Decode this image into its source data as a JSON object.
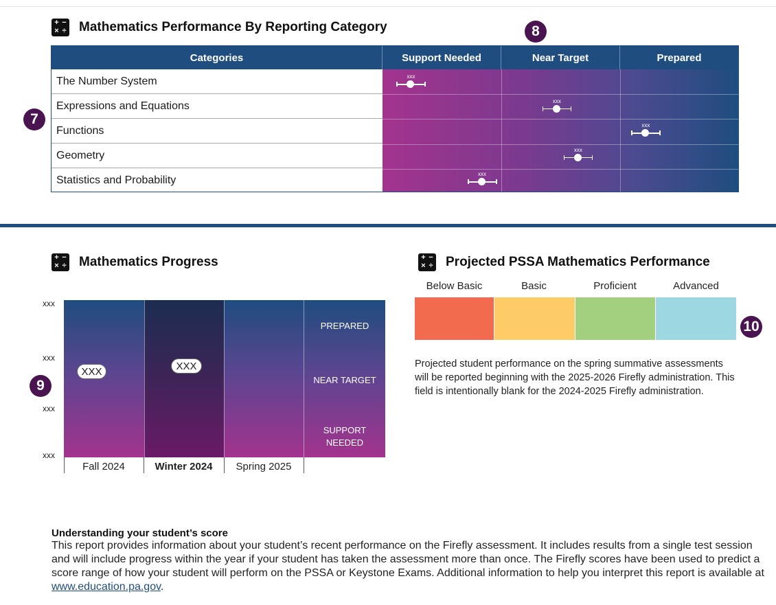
{
  "category_section": {
    "title": "Mathematics Performance By Reporting Category",
    "callout_rows": "7",
    "callout_columns": "8",
    "columns": [
      "Categories",
      "Support Needed",
      "Near Target",
      "Prepared"
    ],
    "rows": [
      {
        "category": "The Number System",
        "label": "xxx",
        "level": 0.08
      },
      {
        "category": "Expressions and Equations",
        "label": "xxx",
        "level": 0.49
      },
      {
        "category": "Functions",
        "label": "xxx",
        "level": 0.74
      },
      {
        "category": "Geometry",
        "label": "xxx",
        "level": 0.55
      },
      {
        "category": "Statistics and Probability",
        "label": "xxx",
        "level": 0.28
      }
    ]
  },
  "progress_section": {
    "title": "Mathematics Progress",
    "callout": "9",
    "y_ticks": [
      "xxx",
      "xxx",
      "xxx",
      "xxx"
    ],
    "levels": [
      "PREPARED",
      "NEAR TARGET",
      "SUPPORT NEEDED"
    ],
    "terms": [
      {
        "label": "Fall 2024",
        "score_label": "XXX",
        "highlight": false
      },
      {
        "label": "Winter 2024",
        "score_label": "XXX",
        "highlight": true
      },
      {
        "label": "Spring  2025",
        "score_label": "",
        "highlight": false
      }
    ]
  },
  "pssa_section": {
    "title": "Projected PSSA Mathematics Performance",
    "callout": "10",
    "bands": [
      {
        "label": "Below Basic",
        "color": "#f26b4f"
      },
      {
        "label": "Basic",
        "color": "#fdcc66"
      },
      {
        "label": "Proficient",
        "color": "#a3d07e"
      },
      {
        "label": "Advanced",
        "color": "#9cd7e2"
      }
    ],
    "note": "Projected student performance on the spring summative assessments will be reported beginning with the 2025-2026 Firefly administration. This field is intentionally blank for the 2024-2025 Firefly administration."
  },
  "footer": {
    "title": "Understanding your student’s score",
    "text": "This report provides information about your student’s recent performance on the Firefly assessment. It includes results from a single test session and will include progress within the year if your student has taken the assessment more than once. The Firefly scores have been used to predict a score range of how your student will perform on the PSSA or Keystone Exams. Additional information to help you interpret this report is available at ",
    "link": "www.education.pa.gov",
    "suffix": "."
  }
}
